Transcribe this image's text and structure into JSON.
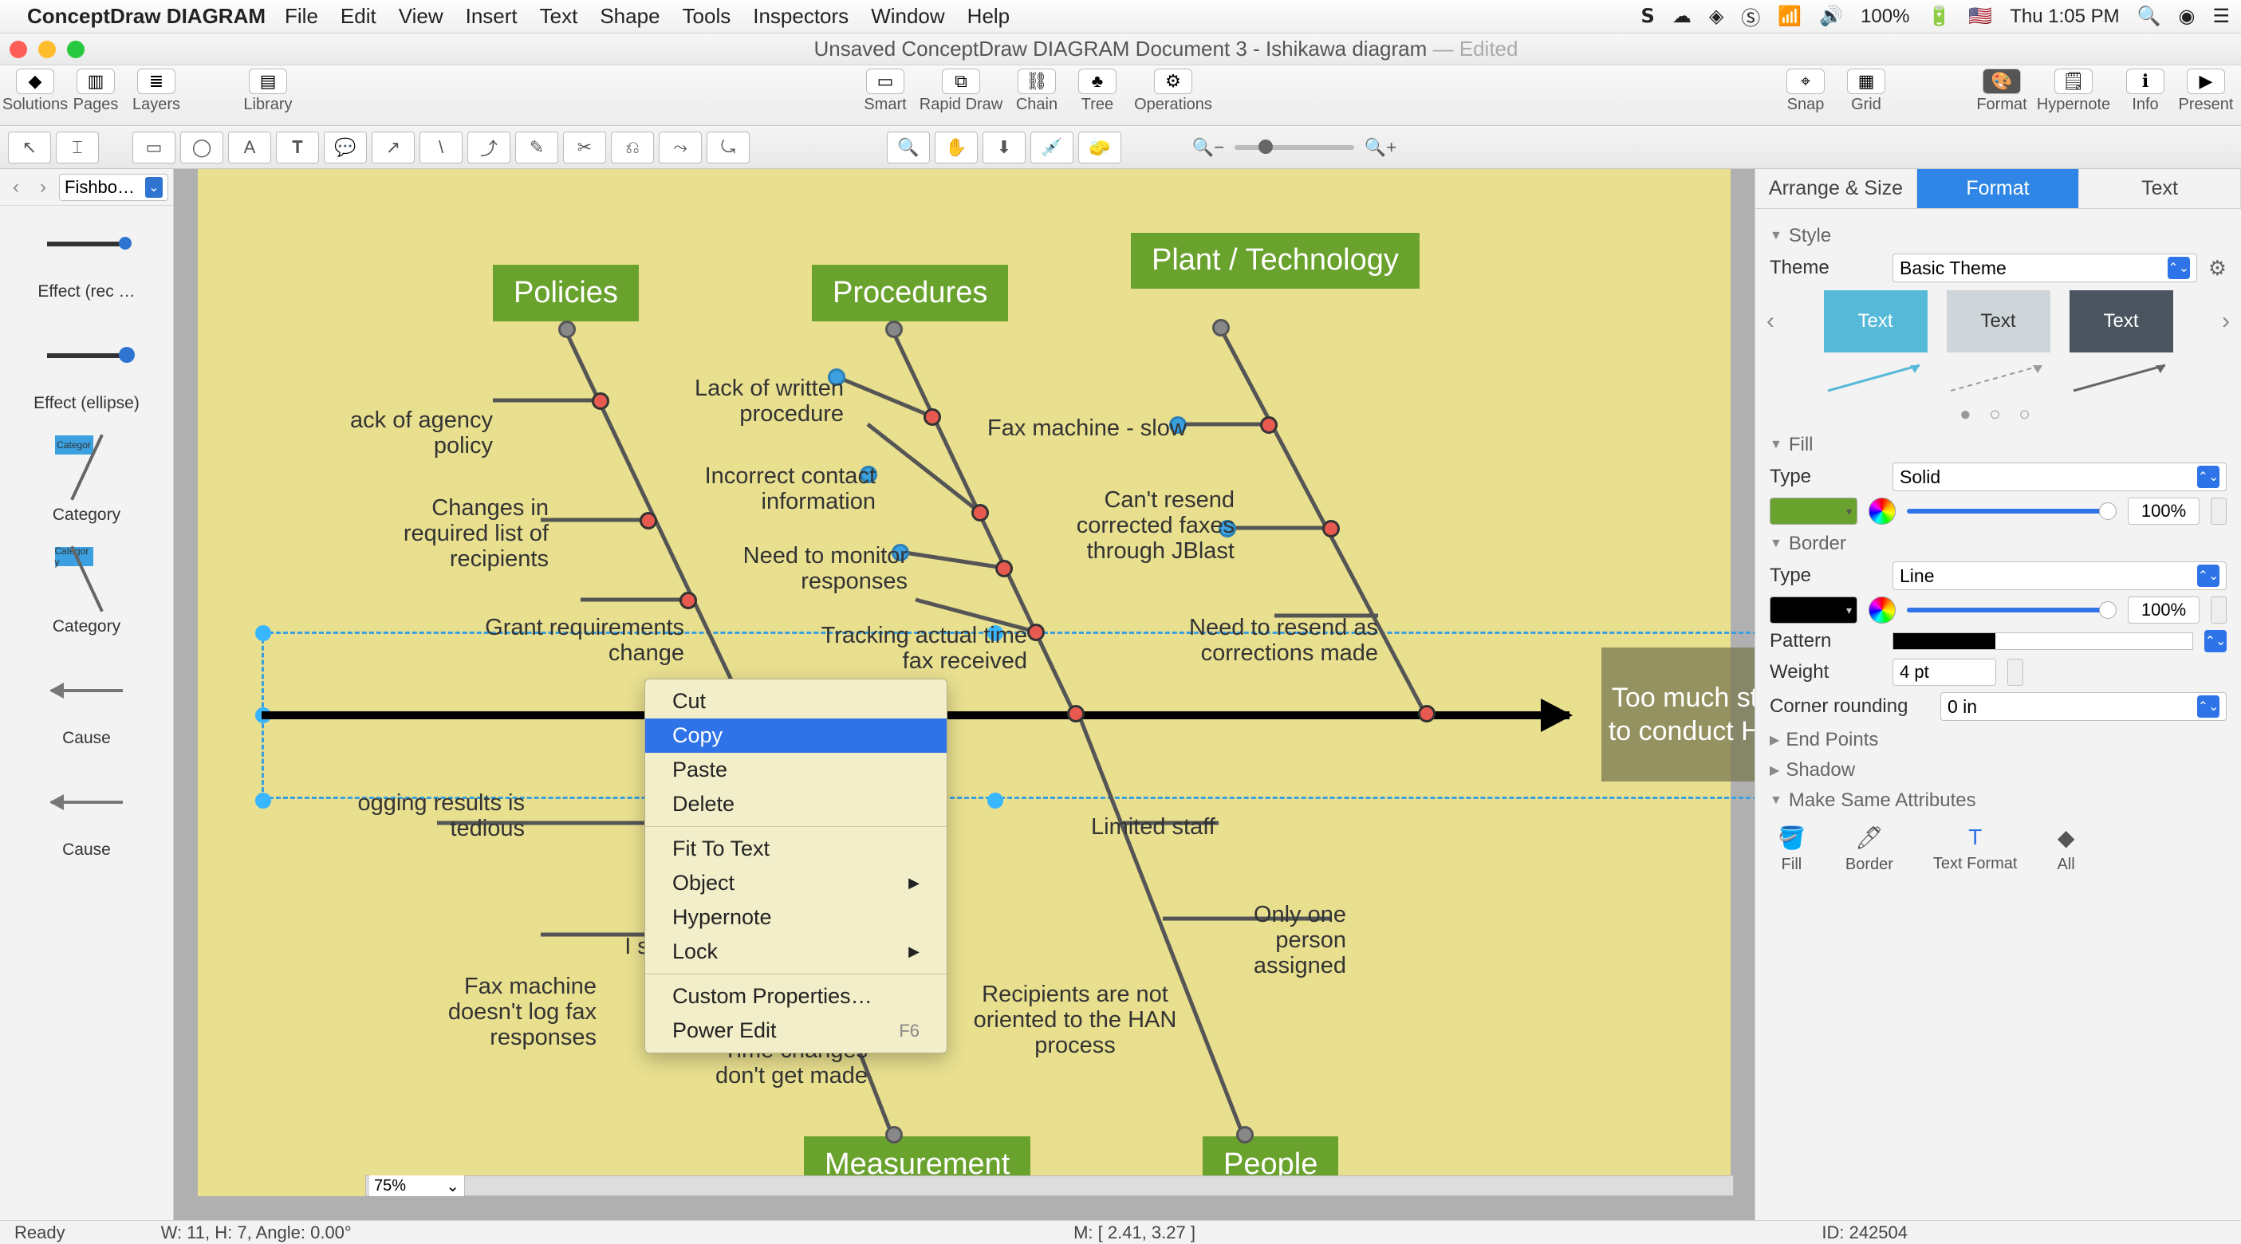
{
  "menubar": {
    "app": "ConceptDraw DIAGRAM",
    "items": [
      "File",
      "Edit",
      "View",
      "Insert",
      "Text",
      "Shape",
      "Tools",
      "Inspectors",
      "Window",
      "Help"
    ],
    "right": {
      "battery_pct": "100%",
      "clock": "Thu 1:05 PM"
    }
  },
  "titlebar": {
    "title": "Unsaved ConceptDraw DIAGRAM Document 3 - Ishikawa diagram",
    "edited": "— Edited"
  },
  "toolbar": {
    "left": [
      {
        "label": "Solutions",
        "icon": "◆"
      },
      {
        "label": "Pages",
        "icon": "▥"
      },
      {
        "label": "Layers",
        "icon": "≣"
      },
      {
        "label": "Library",
        "icon": "▤"
      }
    ],
    "center": [
      {
        "label": "Smart",
        "icon": "▭"
      },
      {
        "label": "Rapid Draw",
        "icon": "⧉"
      },
      {
        "label": "Chain",
        "icon": "⛓"
      },
      {
        "label": "Tree",
        "icon": "♣"
      },
      {
        "label": "Operations",
        "icon": "⚙"
      }
    ],
    "right_a": [
      {
        "label": "Snap",
        "icon": "⌖"
      },
      {
        "label": "Grid",
        "icon": "▦"
      }
    ],
    "right_b": [
      {
        "label": "Format",
        "icon": "🎨"
      },
      {
        "label": "Hypernote",
        "icon": "🗒"
      },
      {
        "label": "Info",
        "icon": "ℹ"
      },
      {
        "label": "Present",
        "icon": "▶"
      }
    ]
  },
  "tools2": [
    "▭",
    "◯",
    "A",
    "𝐓",
    "💬",
    "↗",
    "\\",
    "⤴",
    "✎",
    "✂",
    "⎌",
    "⤳",
    "⤿",
    "",
    "🔍",
    "✋",
    "⬇",
    "💉",
    "🧽",
    "",
    "－",
    "━",
    "＋"
  ],
  "library": {
    "selector": "Fishbo…",
    "items": [
      "Effect (rec …",
      "Effect (ellipse)",
      "Category",
      "Category",
      "Cause",
      "Cause"
    ]
  },
  "diagram": {
    "categories_top": [
      "Policies",
      "Procedures",
      "Plant / Technology"
    ],
    "categories_bottom": [
      "Measurement",
      "People"
    ],
    "effect": "Too much staff time to conduct HAN test",
    "causes": {
      "policies": [
        "ack of agency policy",
        "Changes in required list of recipients",
        "Grant requirements change"
      ],
      "procedures": [
        "Lack of written procedure",
        "Incorrect contact information",
        "Need to monitor responses",
        "Tracking actual time fax received"
      ],
      "plant": [
        "Fax machine - slow",
        "Can't resend corrected faxes through JBlast",
        "Need to resend as corrections made"
      ],
      "measurement": [
        "ogging results is tedious",
        "Fax machine doesn't log fax responses",
        "I sta",
        "Time changes don't get made"
      ],
      "people": [
        "Limited staff",
        "Only one person assigned",
        "Recipients are not oriented to the HAN process"
      ]
    }
  },
  "context_menu": {
    "items": [
      {
        "label": "Cut"
      },
      {
        "label": "Copy",
        "selected": true
      },
      {
        "label": "Paste"
      },
      {
        "label": "Delete"
      },
      {
        "sep": true
      },
      {
        "label": "Fit To Text"
      },
      {
        "label": "Object",
        "sub": true
      },
      {
        "label": "Hypernote"
      },
      {
        "label": "Lock",
        "sub": true
      },
      {
        "sep": true
      },
      {
        "label": "Custom Properties…"
      },
      {
        "label": "Power Edit",
        "shortcut": "F6"
      }
    ]
  },
  "inspector": {
    "tabs": [
      "Arrange & Size",
      "Format",
      "Text"
    ],
    "active_tab": "Format",
    "style": {
      "hdr": "Style",
      "theme_label": "Theme",
      "theme_value": "Basic Theme",
      "swatch_text": "Text"
    },
    "fill": {
      "hdr": "Fill",
      "type_label": "Type",
      "type_value": "Solid",
      "opacity": "100%",
      "color": "#6aa22e"
    },
    "border": {
      "hdr": "Border",
      "type_label": "Type",
      "type_value": "Line",
      "opacity": "100%",
      "pattern_label": "Pattern",
      "weight_label": "Weight",
      "weight_value": "4 pt",
      "corner_label": "Corner rounding",
      "corner_value": "0 in",
      "color": "#000000"
    },
    "endpoints_hdr": "End Points",
    "shadow_hdr": "Shadow",
    "same": {
      "hdr": "Make Same Attributes",
      "btns": [
        "Fill",
        "Border",
        "Text Format",
        "All"
      ]
    }
  },
  "zoom": "75%",
  "status": {
    "ready": "Ready",
    "dims": "W: 11,  H: 7,  Angle: 0.00°",
    "mouse": "M: [ 2.41, 3.27 ]",
    "id": "ID: 242504"
  }
}
